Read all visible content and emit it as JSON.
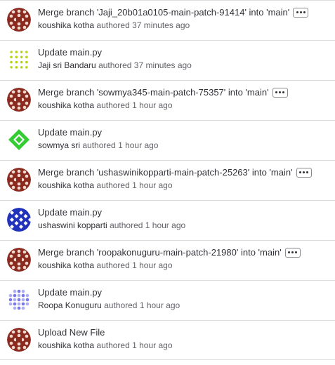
{
  "commits": [
    {
      "title": "Merge branch 'Jaji_20b01a0105-main-patch-91414' into 'main'",
      "author": "koushika kotha",
      "verb": "authored",
      "time": "37 minutes ago",
      "has_menu": true,
      "avatar": "koushika"
    },
    {
      "title": "Update main.py",
      "author": "Jaji sri Bandaru",
      "verb": "authored",
      "time": "37 minutes ago",
      "has_menu": false,
      "avatar": "jaji"
    },
    {
      "title": "Merge branch 'sowmya345-main-patch-75357' into 'main'",
      "author": "koushika kotha",
      "verb": "authored",
      "time": "1 hour ago",
      "has_menu": true,
      "avatar": "koushika"
    },
    {
      "title": "Update main.py",
      "author": "sowmya sri",
      "verb": "authored",
      "time": "1 hour ago",
      "has_menu": false,
      "avatar": "sowmya"
    },
    {
      "title": "Merge branch 'ushaswinikopparti-main-patch-25263' into 'main'",
      "author": "koushika kotha",
      "verb": "authored",
      "time": "1 hour ago",
      "has_menu": true,
      "avatar": "koushika"
    },
    {
      "title": "Update main.py",
      "author": "ushaswini kopparti",
      "verb": "authored",
      "time": "1 hour ago",
      "has_menu": false,
      "avatar": "ushaswini"
    },
    {
      "title": "Merge branch 'roopakonuguru-main-patch-21980' into 'main'",
      "author": "koushika kotha",
      "verb": "authored",
      "time": "1 hour ago",
      "has_menu": true,
      "avatar": "koushika"
    },
    {
      "title": "Update main.py",
      "author": "Roopa Konuguru",
      "verb": "authored",
      "time": "1 hour ago",
      "has_menu": false,
      "avatar": "roopa"
    },
    {
      "title": "Upload New File",
      "author": "koushika kotha",
      "verb": "authored",
      "time": "1 hour ago",
      "has_menu": false,
      "avatar": "koushika"
    }
  ],
  "icons": {
    "ellipsis": "ellipsis-h-icon"
  },
  "colors": {
    "avatar_koushika": "#8b2b1f",
    "avatar_jaji": "#b5d31a",
    "avatar_sowmya": "#33cc33",
    "avatar_ushaswini": "#2233bb",
    "avatar_roopa": "#7777ee"
  }
}
